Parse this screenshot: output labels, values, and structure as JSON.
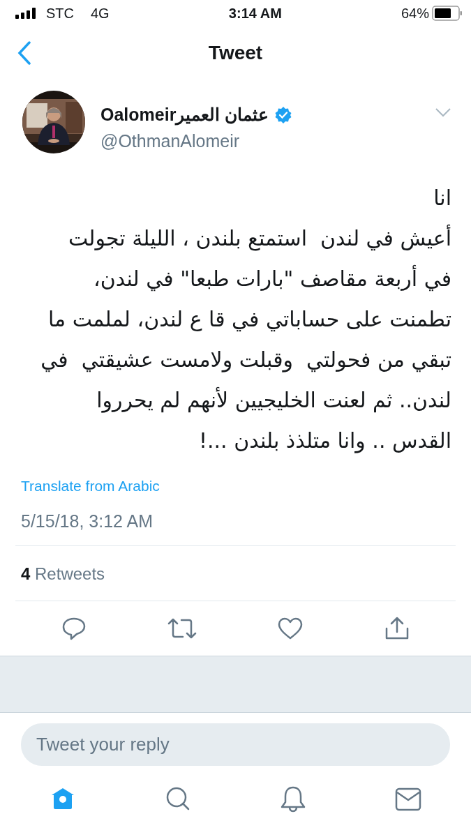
{
  "status_bar": {
    "carrier": "STC",
    "network": "4G",
    "time": "3:14 AM",
    "battery": "64%"
  },
  "nav": {
    "title": "Tweet"
  },
  "tweet": {
    "name": "Oalomeirعثمان العمير",
    "verified": true,
    "handle": "@OthmanAlomeir",
    "text": "انا\nأعيش في لندن  استمتع بلندن ، الليلة تجولت\nفي أربعة مقاصف \"بارات طبعا\" في لندن،\nتطمنت على حساباتي في قا ع لندن، لملمت ما\nتبقي من فحولتي  وقبلت ولامست عشيقتي  في\nلندن.. ثم لعنت الخليجيين لأنهم لم يحرروا\nالقدس .. وانا متلذذ بلندن ...!",
    "translate": "Translate from Arabic",
    "date": "5/15/18, 3:12 AM",
    "retweets": "**4** Retweets"
  },
  "reply": {
    "placeholder": "Tweet your reply"
  },
  "tabs": [
    {
      "kind": "home",
      "selected": true
    },
    {
      "kind": "search",
      "selected": false
    },
    {
      "kind": "notifications",
      "selected": false
    },
    {
      "kind": "messages",
      "selected": false
    }
  ]
}
